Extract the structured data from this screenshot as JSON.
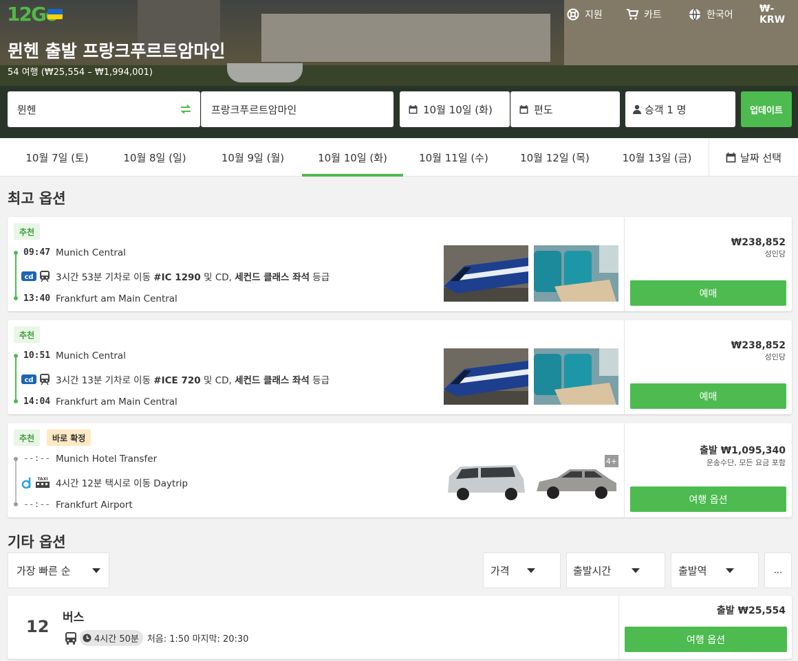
{
  "header": {
    "logo_text": "12Go",
    "nav": [
      {
        "label": "지원",
        "icon": "lifebuoy-icon"
      },
      {
        "label": "카트",
        "icon": "cart-icon"
      },
      {
        "label": "한국어",
        "icon": "globe-icon"
      },
      {
        "label": "₩-KRW",
        "icon": ""
      }
    ],
    "title": "뮌헨 출발 프랑크푸르트암마인",
    "subtitle": "54 여행 (₩25,554 – ₩1,994,001)"
  },
  "search": {
    "from": "뮌헨",
    "to": "프랑크푸르트암마인",
    "date": "10월 10일 (화)",
    "return": "편도",
    "passengers": "승객 1 명",
    "update_label": "업데이트"
  },
  "date_tabs": [
    {
      "label": "10월 7일 (토)",
      "active": false
    },
    {
      "label": "10월 8일 (일)",
      "active": false
    },
    {
      "label": "10월 9일 (월)",
      "active": false
    },
    {
      "label": "10월 10일 (화)",
      "active": true
    },
    {
      "label": "10월 11일 (수)",
      "active": false
    },
    {
      "label": "10월 12일 (목)",
      "active": false
    },
    {
      "label": "10월 13일 (금)",
      "active": false
    }
  ],
  "date_select_label": "날짜 선택",
  "best_title": "최고 옵션",
  "best_options": [
    {
      "badges": [
        "추천"
      ],
      "dep_time": "09:47",
      "dep_place": "Munich Central",
      "arr_time": "13:40",
      "arr_place": "Frankfurt am Main Central",
      "desc_pre": "3시간 53분 기차로 이동 ",
      "desc_bold": "#IC 1290",
      "desc_mid": " 및 CD, ",
      "desc_bold2": "세컨드 클래스 좌석",
      "desc_post": " 등급",
      "price": "₩238,852",
      "price_note": "성인당",
      "button": "예매"
    },
    {
      "badges": [
        "추천"
      ],
      "dep_time": "10:51",
      "dep_place": "Munich Central",
      "arr_time": "14:04",
      "arr_place": "Frankfurt am Main Central",
      "desc_pre": "3시간 13분 기차로 이동 ",
      "desc_bold": "#ICE 720",
      "desc_mid": " 및 CD, ",
      "desc_bold2": "세컨드 클래스 좌석",
      "desc_post": " 등급",
      "price": "₩238,852",
      "price_note": "성인당",
      "button": "예매"
    },
    {
      "badges": [
        "추천",
        "바로 확정"
      ],
      "dep_time": "--:--",
      "dep_place": "Munich Hotel Transfer",
      "arr_time": "--:--",
      "arr_place": "Frankfurt Airport",
      "desc_pre": "4시간 12분 택시로 이동 Daytrip",
      "price_prefix": "출발",
      "price": "₩1,095,340",
      "price_note": "운송수단, 모든 요금 포함",
      "button": "여행 옵션",
      "more_badge": "4+"
    }
  ],
  "other_title": "기타 옵션",
  "filters": {
    "sort": "가장 빠른 순",
    "price": "가격",
    "departure_time": "출발시간",
    "departure_station": "출발역",
    "more": "..."
  },
  "bus_result": {
    "count": "12",
    "type": "버스",
    "duration": "4시간 50분",
    "schedule": "처음: 1:50 마지막: 20:30",
    "price_prefix": "출발",
    "price": "₩25,554",
    "button": "여행 옵션"
  },
  "colors": {
    "accent": "#4dbb4f",
    "badge_green_bg": "#e8f6e6",
    "badge_orange_bg": "#ffe9c2"
  }
}
